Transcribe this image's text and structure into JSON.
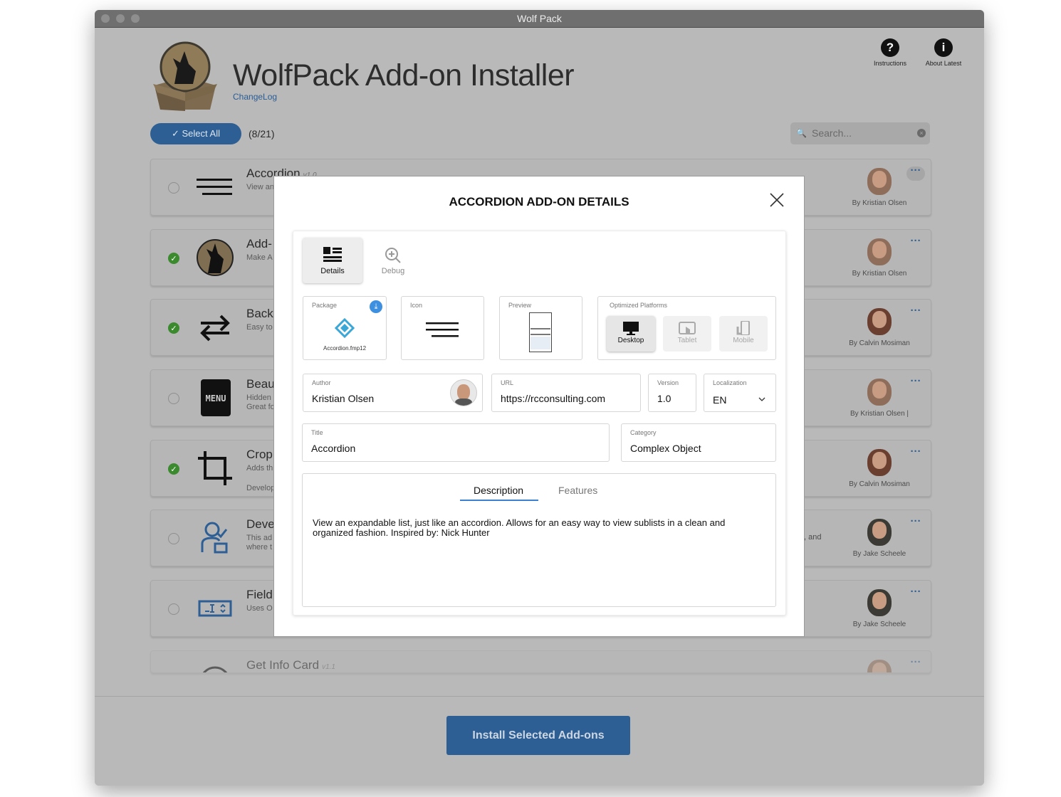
{
  "window": {
    "title": "Wolf Pack"
  },
  "header": {
    "app_title": "WolfPack Add-on Installer",
    "changelog_label": "ChangeLog",
    "instructions_label": "Instructions",
    "about_label": "About Latest"
  },
  "toolbar": {
    "select_all_label": "Select All",
    "count_label": "(8/21)",
    "search_placeholder": "Search..."
  },
  "addons": [
    {
      "title": "Accordion",
      "version": "v1.0",
      "desc": "View an",
      "desc2": "",
      "desc3": "",
      "right": "",
      "author": "By Kristian Olsen",
      "selected": false,
      "icon": "hamburger-lines-icon"
    },
    {
      "title": "Add-",
      "version": "",
      "desc": "Make A",
      "desc2": "",
      "desc3": "",
      "right": "",
      "author": "By Kristian Olsen",
      "selected": true,
      "icon": "wolf-icon"
    },
    {
      "title": "Back",
      "version": "",
      "desc": "Easy to",
      "desc2": "",
      "desc3": "",
      "right": "",
      "author": "By Calvin Mosiman",
      "selected": true,
      "icon": "arrows-exchange-icon"
    },
    {
      "title": "Beau",
      "version": "",
      "desc": "Hidden",
      "desc2": "Great fo",
      "desc3": "",
      "right": "",
      "author": "By Kristian Olsen |",
      "selected": false,
      "icon": "menu-notebook-icon"
    },
    {
      "title": "Crop",
      "version": "",
      "desc": "Adds th",
      "desc2": "",
      "desc3": "Develop",
      "right": "",
      "author": "By Calvin Mosiman",
      "selected": true,
      "icon": "crop-icon"
    },
    {
      "title": "Deve",
      "version": "",
      "desc": "This ad",
      "desc2": "where t",
      "desc3": "",
      "right": "t, and",
      "author": "By Jake Scheele",
      "selected": false,
      "icon": "developer-user-icon"
    },
    {
      "title": "Field",
      "version": "",
      "desc": "Uses O",
      "desc2": "",
      "desc3": "",
      "right": "",
      "author": "By Jake Scheele",
      "selected": false,
      "icon": "field-input-icon"
    },
    {
      "title": "Get Info Card",
      "version": "v1.1",
      "desc": "",
      "desc2": "",
      "desc3": "",
      "right": "",
      "author": "",
      "selected": false,
      "icon": "info-card-icon"
    }
  ],
  "footer": {
    "install_label": "Install Selected Add-ons"
  },
  "modal": {
    "title": "ACCORDION ADD-ON DETAILS",
    "tabs": {
      "details": "Details",
      "debug": "Debug"
    },
    "package": {
      "label": "Package",
      "filename": "Accordion.fmp12"
    },
    "icon_label": "Icon",
    "preview_label": "Preview",
    "platforms": {
      "label": "Optimized Platforms",
      "desktop": "Desktop",
      "tablet": "Tablet",
      "mobile": "Mobile"
    },
    "author": {
      "label": "Author",
      "value": "Kristian Olsen"
    },
    "url": {
      "label": "URL",
      "value": "https://rcconsulting.com"
    },
    "version": {
      "label": "Version",
      "value": "1.0"
    },
    "localization": {
      "label": "Localization",
      "value": "EN"
    },
    "title_field": {
      "label": "Title",
      "value": "Accordion"
    },
    "category": {
      "label": "Category",
      "value": "Complex Object"
    },
    "desc_tabs": {
      "description": "Description",
      "features": "Features"
    },
    "description_text": "View an expandable list, just like an accordion. Allows for an easy way to view sublists in a clean and organized fashion. Inspired by: Nick Hunter"
  },
  "colors": {
    "accent": "#2d5f95",
    "check_green": "#3b8a2e",
    "tab_underline": "#3d7fd0"
  }
}
